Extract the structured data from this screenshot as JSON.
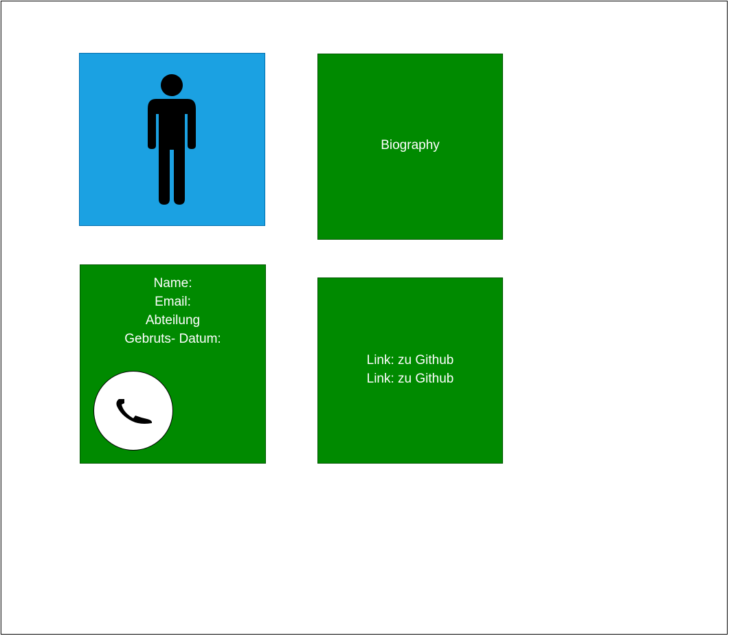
{
  "profile": {
    "avatar_icon": "person-icon",
    "avatar_color": "#1ba1e2"
  },
  "biography": {
    "label": "Biography"
  },
  "info": {
    "name_label": "Name:",
    "email_label": "Email:",
    "department_label": "Abteilung",
    "birthdate_label": "Gebruts- Datum:",
    "phone_icon": "phone-icon"
  },
  "links": {
    "items": [
      "Link: zu Github",
      "Link: zu Github"
    ]
  },
  "colors": {
    "panel_green": "#008a00",
    "panel_blue": "#1ba1e2",
    "text": "#ffffff"
  }
}
